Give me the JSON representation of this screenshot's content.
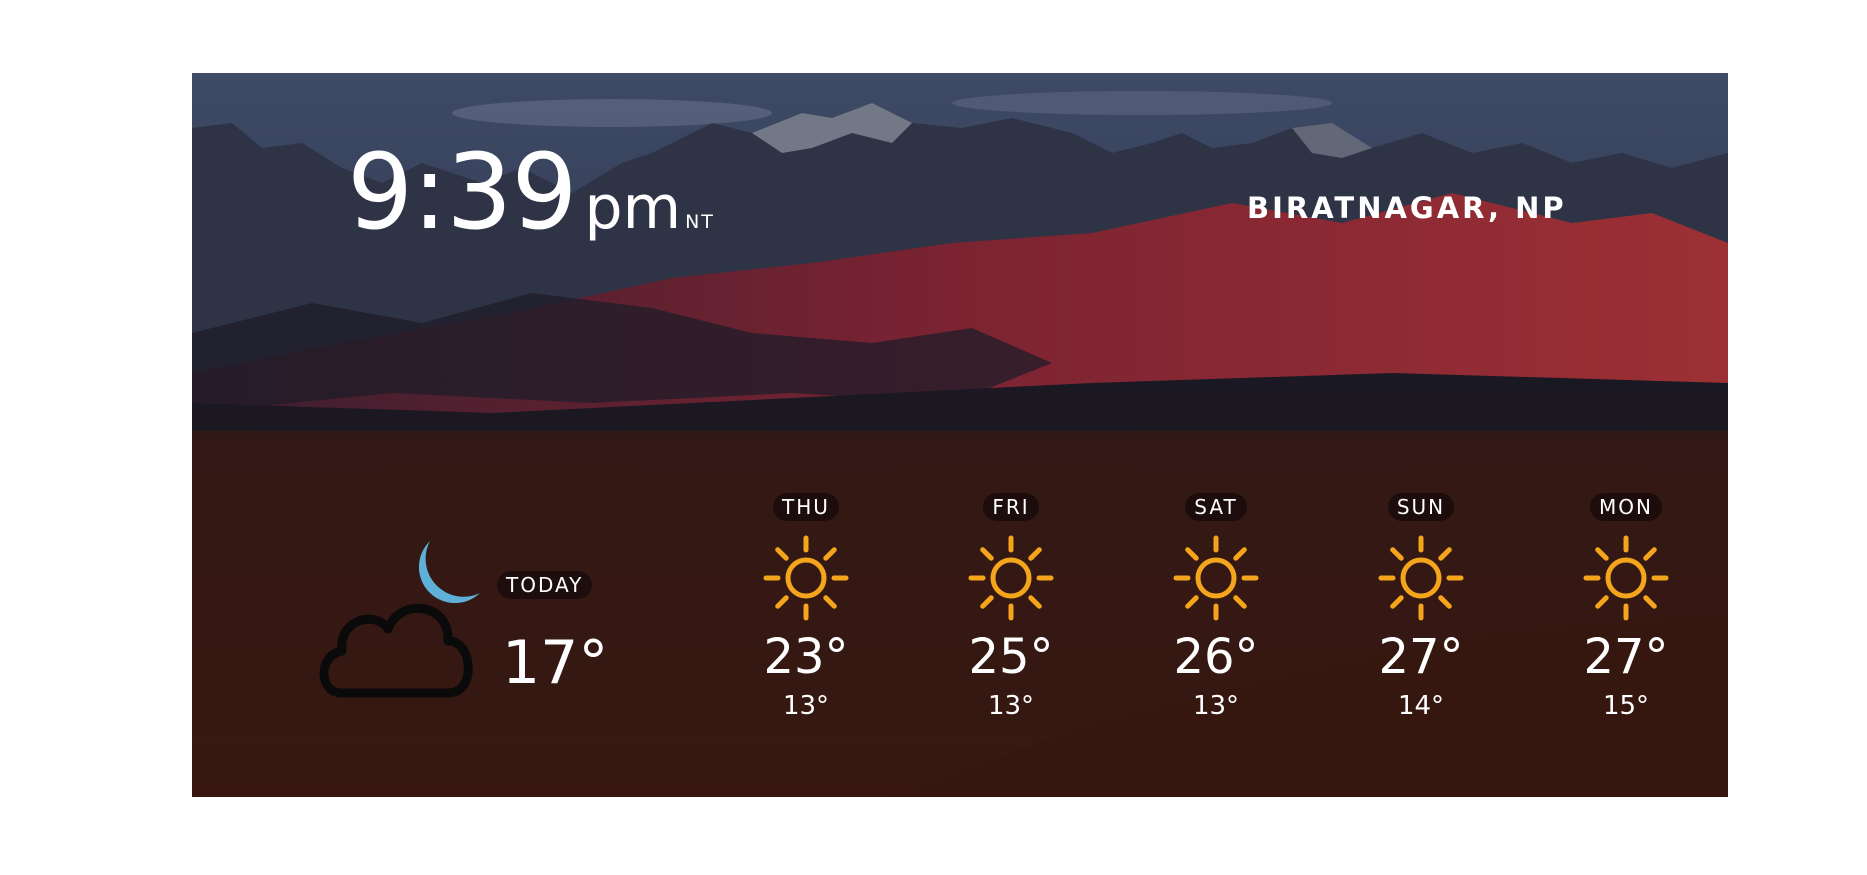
{
  "clock": {
    "time": "9:39",
    "ampm": "pm",
    "tz": "NT"
  },
  "location": "BIRATNAGAR, NP",
  "today": {
    "label": "TODAY",
    "temp": "17°",
    "icon": "cloud-moon-icon"
  },
  "forecast": [
    {
      "day": "THU",
      "high": "23°",
      "low": "13°",
      "icon": "sun-icon"
    },
    {
      "day": "FRI",
      "high": "25°",
      "low": "13°",
      "icon": "sun-icon"
    },
    {
      "day": "SAT",
      "high": "26°",
      "low": "13°",
      "icon": "sun-icon"
    },
    {
      "day": "SUN",
      "high": "27°",
      "low": "14°",
      "icon": "sun-icon"
    },
    {
      "day": "MON",
      "high": "27°",
      "low": "15°",
      "icon": "sun-icon"
    }
  ],
  "colors": {
    "sun": "#f4a51c",
    "moon": "#5eb0d8",
    "panel": "#401a0e"
  }
}
